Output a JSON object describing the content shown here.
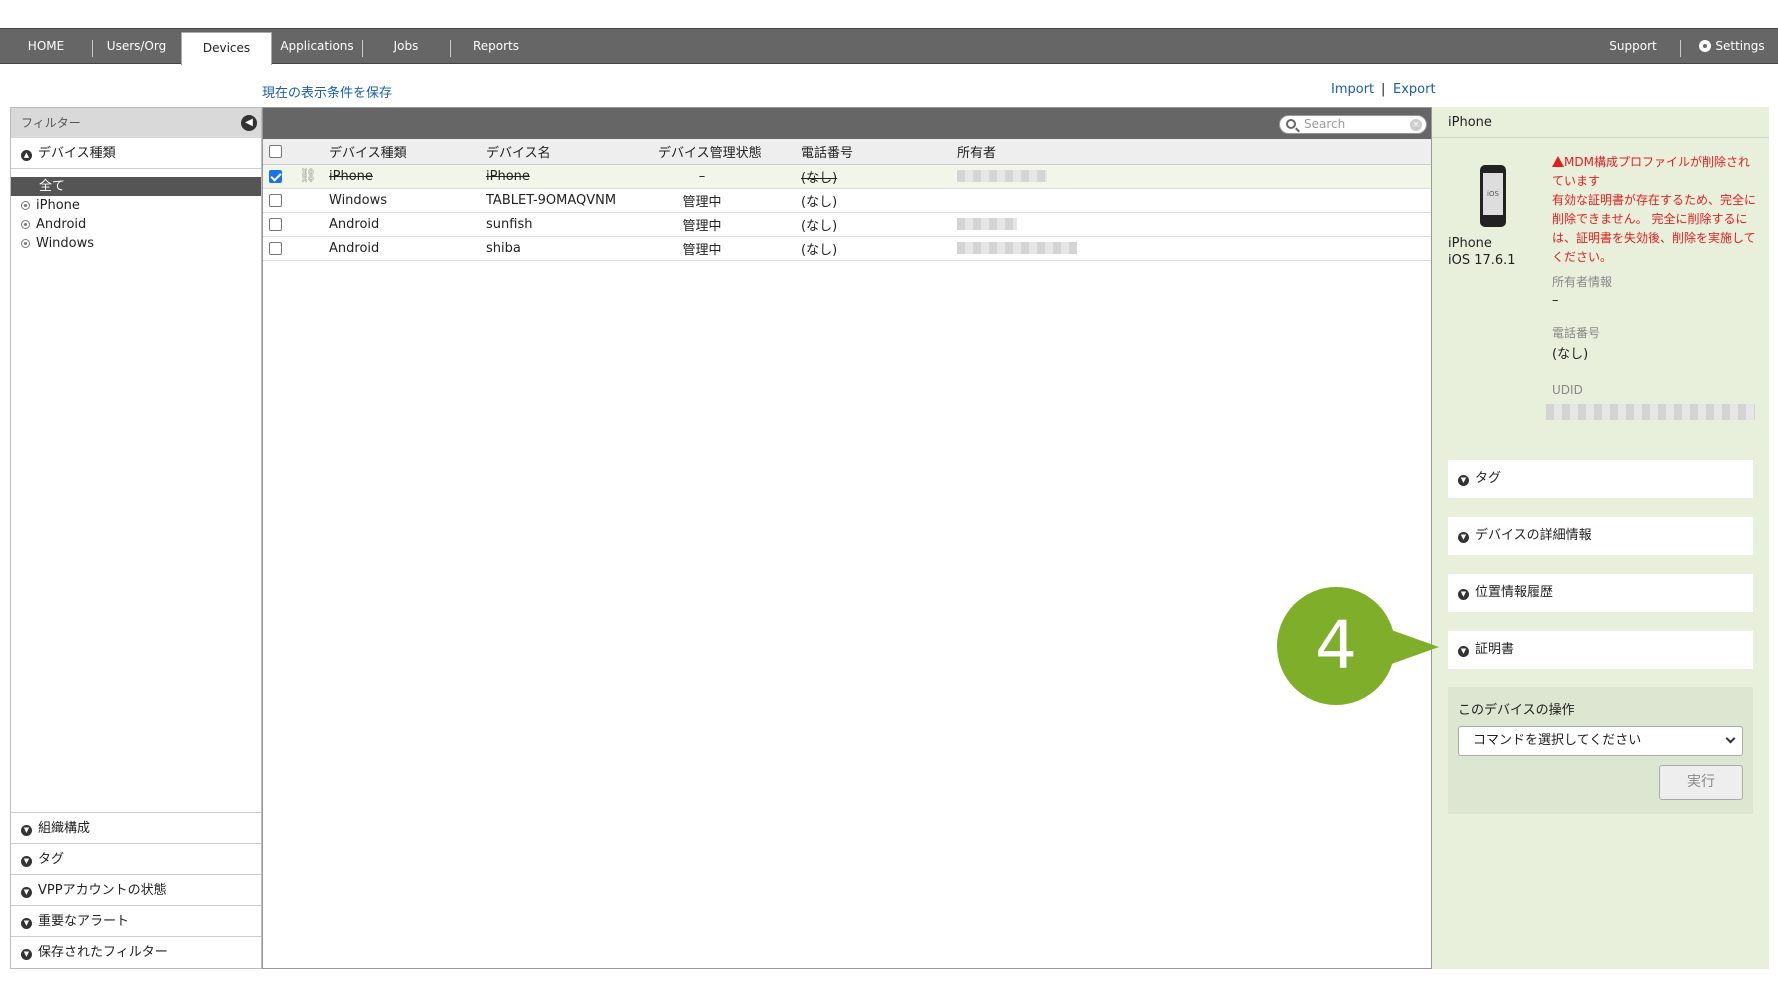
{
  "nav": {
    "tabs": [
      {
        "label": "HOME"
      },
      {
        "label": "Users/Org"
      },
      {
        "label": "Devices"
      },
      {
        "label": "Applications"
      },
      {
        "label": "Jobs"
      },
      {
        "label": "Reports"
      }
    ],
    "support": "Support",
    "settings": "Settings",
    "active_tab": "Devices"
  },
  "toolbar": {
    "save_view": "現在の表示条件を保存",
    "import": "Import",
    "separator": "|",
    "export": "Export"
  },
  "filter": {
    "header": "フィルター",
    "device_type_label": "デバイス種類",
    "options": [
      "全て",
      "iPhone",
      "Android",
      "Windows"
    ],
    "selected": "全て",
    "sections": [
      "組織構成",
      "タグ",
      "VPPアカウントの状態",
      "重要なアラート",
      "保存されたフィルター"
    ]
  },
  "search": {
    "placeholder": "Search"
  },
  "table": {
    "columns": [
      "デバイス種類",
      "デバイス名",
      "デバイス管理状態",
      "電話番号",
      "所有者"
    ],
    "rows": [
      {
        "checked": true,
        "type": "iPhone",
        "name": "iPhone",
        "status": "–",
        "phone": "(なし)",
        "owner": "",
        "removed": true
      },
      {
        "checked": false,
        "type": "Windows",
        "name": "TABLET-9OMAQVNM",
        "status": "管理中",
        "phone": "(なし)",
        "owner": "",
        "removed": false
      },
      {
        "checked": false,
        "type": "Android",
        "name": "sunfish",
        "status": "管理中",
        "phone": "(なし)",
        "owner": "",
        "removed": false
      },
      {
        "checked": false,
        "type": "Android",
        "name": "shiba",
        "status": "管理中",
        "phone": "(なし)",
        "owner": "",
        "removed": false
      }
    ]
  },
  "detail": {
    "header": "iPhone",
    "device_model": "iPhone",
    "os_version": "iOS 17.6.1",
    "warning_title": "MDM構成プロファイルが削除されています",
    "warning_body": "有効な証明書が存在するため、完全に削除できません。 完全に削除するには、証明書を失効後、削除を実施してください。",
    "owner_label": "所有者情報",
    "owner_value": "–",
    "phone_label": "電話番号",
    "phone_value": "(なし)",
    "udid_label": "UDID",
    "panels": [
      "タグ",
      "デバイスの詳細情報",
      "位置情報履歴",
      "証明書"
    ],
    "ops_title": "このデバイスの操作",
    "command_placeholder": "コマンドを選択してください",
    "run_label": "実行"
  },
  "callout": {
    "number": "4",
    "color": "#7fae2a"
  },
  "colors": {
    "nav_bg": "#666666",
    "link": "#1a5ea8",
    "warning": "#e02020",
    "detail_bg": "#e8f0dc"
  }
}
